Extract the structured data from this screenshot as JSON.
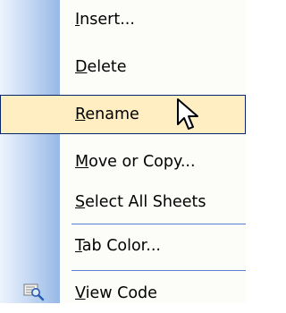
{
  "context_menu": {
    "items": [
      {
        "id": "insert",
        "mnemonic": "I",
        "rest": "nsert...",
        "selected": false,
        "icon": null
      },
      {
        "id": "delete",
        "mnemonic": "D",
        "rest": "elete",
        "selected": false,
        "icon": null
      },
      {
        "id": "rename",
        "mnemonic": "R",
        "rest": "ename",
        "selected": true,
        "icon": null
      },
      {
        "id": "move-or-copy",
        "mnemonic": "M",
        "rest": "ove or Copy...",
        "selected": false,
        "icon": null
      },
      {
        "id": "select-all-sheets",
        "mnemonic": "S",
        "rest": "elect All Sheets",
        "selected": false,
        "icon": null
      },
      {
        "id": "tab-color",
        "mnemonic": "T",
        "rest": "ab Color...",
        "selected": false,
        "icon": null
      },
      {
        "id": "view-code",
        "mnemonic": "V",
        "rest": "iew Code",
        "selected": false,
        "icon": "view-code-icon"
      }
    ],
    "colors": {
      "highlight_bg": "#ffeec2",
      "highlight_border": "#0a246a",
      "separator": "#5d7fd0",
      "gutter_light": "#edf3fd",
      "gutter_dark": "#97b8e6"
    }
  },
  "cursor": {
    "icon": "arrow-pointer-icon"
  }
}
